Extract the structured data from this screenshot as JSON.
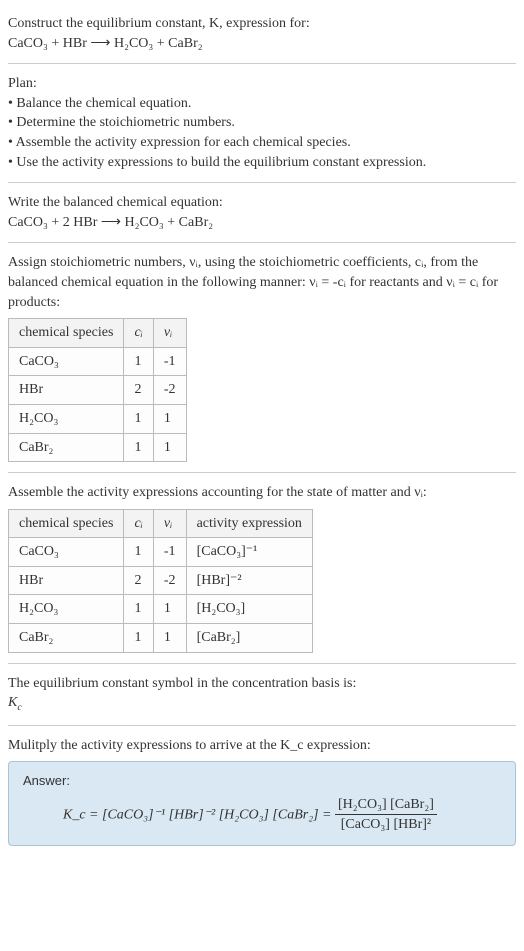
{
  "chart_data": [
    {
      "type": "table",
      "title": "Stoichiometric numbers",
      "columns": [
        "chemical species",
        "c_i",
        "ν_i"
      ],
      "rows": [
        [
          "CaCO3",
          "1",
          "-1"
        ],
        [
          "HBr",
          "2",
          "-2"
        ],
        [
          "H2CO3",
          "1",
          "1"
        ],
        [
          "CaBr2",
          "1",
          "1"
        ]
      ]
    },
    {
      "type": "table",
      "title": "Activity expressions",
      "columns": [
        "chemical species",
        "c_i",
        "ν_i",
        "activity expression"
      ],
      "rows": [
        [
          "CaCO3",
          "1",
          "-1",
          "[CaCO3]^(-1)"
        ],
        [
          "HBr",
          "2",
          "-2",
          "[HBr]^(-2)"
        ],
        [
          "H2CO3",
          "1",
          "1",
          "[H2CO3]"
        ],
        [
          "CaBr2",
          "1",
          "1",
          "[CaBr2]"
        ]
      ]
    }
  ],
  "intro": {
    "line1": "Construct the equilibrium constant, K, expression for:",
    "eq": "CaCO₃ + HBr ⟶ H₂CO₃ + CaBr₂"
  },
  "plan": {
    "title": "Plan:",
    "b1": "• Balance the chemical equation.",
    "b2": "• Determine the stoichiometric numbers.",
    "b3": "• Assemble the activity expression for each chemical species.",
    "b4": "• Use the activity expressions to build the equilibrium constant expression."
  },
  "balanced": {
    "title": "Write the balanced chemical equation:",
    "eq": "CaCO₃ + 2 HBr ⟶ H₂CO₃ + CaBr₂"
  },
  "stoich": {
    "text": "Assign stoichiometric numbers, νᵢ, using the stoichiometric coefficients, cᵢ, from the balanced chemical equation in the following manner: νᵢ = -cᵢ for reactants and νᵢ = cᵢ for products:",
    "h1": "chemical species",
    "h2": "cᵢ",
    "h3": "νᵢ",
    "r1c1": "CaCO₃",
    "r1c2": "1",
    "r1c3": "-1",
    "r2c1": "HBr",
    "r2c2": "2",
    "r2c3": "-2",
    "r3c1": "H₂CO₃",
    "r3c2": "1",
    "r3c3": "1",
    "r4c1": "CaBr₂",
    "r4c2": "1",
    "r4c3": "1"
  },
  "activity": {
    "text": "Assemble the activity expressions accounting for the state of matter and νᵢ:",
    "h1": "chemical species",
    "h2": "cᵢ",
    "h3": "νᵢ",
    "h4": "activity expression",
    "r1c1": "CaCO₃",
    "r1c2": "1",
    "r1c3": "-1",
    "r1c4": "[CaCO₃]⁻¹",
    "r2c1": "HBr",
    "r2c2": "2",
    "r2c3": "-2",
    "r2c4": "[HBr]⁻²",
    "r3c1": "H₂CO₃",
    "r3c2": "1",
    "r3c3": "1",
    "r3c4": "[H₂CO₃]",
    "r4c1": "CaBr₂",
    "r4c2": "1",
    "r4c3": "1",
    "r4c4": "[CaBr₂]"
  },
  "symbol": {
    "line1": "The equilibrium constant symbol in the concentration basis is:",
    "line2": "K_c"
  },
  "multiply": {
    "text": "Mulitply the activity expressions to arrive at the K_c expression:"
  },
  "answer": {
    "label": "Answer:",
    "lhs": "K_c = [CaCO₃]⁻¹ [HBr]⁻² [H₂CO₃] [CaBr₂] = ",
    "num": "[H₂CO₃] [CaBr₂]",
    "den": "[CaCO₃] [HBr]²"
  }
}
